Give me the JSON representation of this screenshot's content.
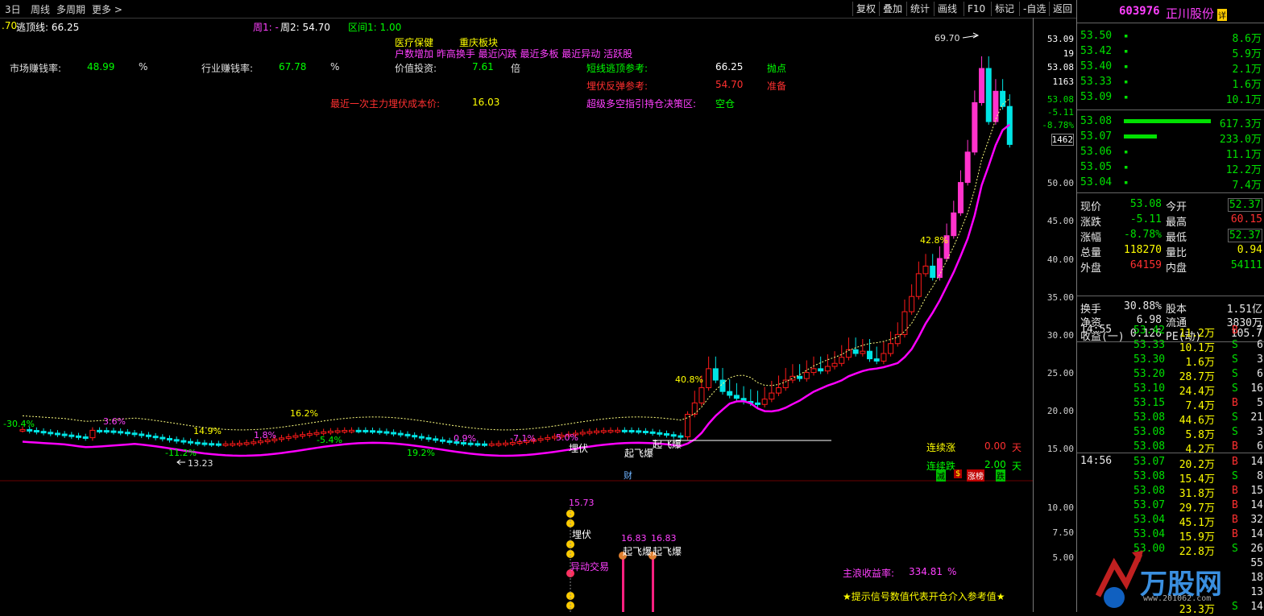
{
  "toolbar": {
    "left": [
      "3日",
      "周线",
      "多周期",
      "更多 >"
    ],
    "right": [
      "复权",
      "叠加",
      "统计",
      "画线",
      "F10",
      "标记",
      "-自选",
      "返回"
    ]
  },
  "indicator_line": {
    "prefix": ".70",
    "escape_label": "逃顶线: 66.25",
    "week1": "周1: -",
    "week2": "周2: 54.70",
    "range": "区间1: 1.00"
  },
  "sector": {
    "tag1": "医疗保健",
    "tag2": "重庆板块",
    "line2": "户数增加 昨高换手 最近闪跌 最近多板 最近异动 活跃股"
  },
  "stats": {
    "market_label": "市场赚钱率:",
    "market_value": "48.99",
    "market_unit": "%",
    "industry_label": "行业赚钱率:",
    "industry_value": "67.78",
    "industry_unit": "%",
    "value_label": "价值投资:",
    "value_value": "7.61",
    "value_unit": "倍",
    "short_label": "短线逃顶参考:",
    "short_value": "66.25",
    "short_tag": "抛点",
    "rebound_label": "埋伏反弹参考:",
    "rebound_value": "54.70",
    "rebound_tag": "准备",
    "cost_label": "最近一次主力埋伏成本价:",
    "cost_value": "16.03",
    "strategy_label": "超级多空指引持仓决策区:",
    "strategy_value": "空仓"
  },
  "chart_labels": {
    "peak": "69.70",
    "low": "13.23",
    "pcts": [
      "-30.4%",
      "3.6%",
      "14.9%",
      "16.2%",
      "-11.2%",
      "1.8%",
      "-5.4%",
      "19.2%",
      "0.9%",
      "-7.1%",
      "5.0%",
      "40.8%",
      "42.8%"
    ],
    "signals": [
      "埋伏",
      "起飞爆",
      "起飞爆",
      "财"
    ],
    "lianxu_zhang": "连续涨",
    "lianxu_zhang_val": "0.00",
    "lianxu_zhang_unit": "天",
    "lianxu_die": "连续跌",
    "lianxu_die_val": "2.00",
    "lianxu_die_unit": "天",
    "bottom_tags": [
      "减",
      "$",
      "涨榜",
      "跌"
    ]
  },
  "sub_chart": {
    "val1": "15.73",
    "val2": "16.83",
    "val3": "16.83",
    "sig1": "埋伏",
    "sig2": "起飞爆",
    "sig3": "起飞爆",
    "sig4": "异动交易",
    "profit_label": "主浪收益率:",
    "profit_value": "334.81",
    "profit_unit": "%",
    "note": "★提示信号数值代表开仓介入参考值★"
  },
  "price_axis": {
    "main": [
      "50.00",
      "45.00",
      "40.00",
      "35.00",
      "30.00",
      "25.00",
      "20.00",
      "15.00"
    ],
    "sub": [
      "10.00",
      "7.50",
      "5.00"
    ],
    "flags": [
      "53.09",
      "19",
      "53.08",
      "1163",
      "53.08",
      "-5.11",
      "-8.78%",
      "1462"
    ]
  },
  "quote": {
    "code": "603976",
    "name": "正川股份",
    "badge": "详",
    "asks": [
      {
        "p": "53.50",
        "v": "8.6万"
      },
      {
        "p": "53.42",
        "v": "5.9万"
      },
      {
        "p": "53.40",
        "v": "2.1万"
      },
      {
        "p": "53.33",
        "v": "1.6万"
      },
      {
        "p": "53.09",
        "v": "10.1万"
      }
    ],
    "bids": [
      {
        "p": "53.08",
        "v": "617.3万",
        "bar": 1.0
      },
      {
        "p": "53.07",
        "v": "233.0万",
        "bar": 0.38
      },
      {
        "p": "53.06",
        "v": "11.1万",
        "bar": 0
      },
      {
        "p": "53.05",
        "v": "12.2万",
        "bar": 0
      },
      {
        "p": "53.04",
        "v": "7.4万",
        "bar": 0
      }
    ],
    "info": [
      {
        "l1": "现价",
        "v1": "53.08",
        "l2": "今开",
        "v2": "52.37",
        "c1": "green",
        "c2": "green",
        "b2": true
      },
      {
        "l1": "涨跌",
        "v1": "-5.11",
        "l2": "最高",
        "v2": "60.15",
        "c1": "green",
        "c2": "red",
        "b2": false
      },
      {
        "l1": "涨幅",
        "v1": "-8.78%",
        "l2": "最低",
        "v2": "52.37",
        "c1": "green",
        "c2": "green",
        "b2": true
      },
      {
        "l1": "总量",
        "v1": "118270",
        "l2": "量比",
        "v2": "0.94",
        "c1": "yellow",
        "c2": "yellow",
        "b2": false
      },
      {
        "l1": "外盘",
        "v1": "64159",
        "l2": "内盘",
        "v2": "54111",
        "c1": "red",
        "c2": "green",
        "b2": false
      }
    ],
    "info2": [
      {
        "l1": "换手",
        "v1": "30.88%",
        "l2": "股本",
        "v2": "1.51亿"
      },
      {
        "l1": "净资",
        "v1": "6.98",
        "l2": "流通",
        "v2": "3830万"
      },
      {
        "l1": "收益(一)",
        "v1": "0.126",
        "l2": "PE(动)",
        "v2": "105.7"
      }
    ],
    "ticks1_time": "14:55",
    "ticks1": [
      {
        "p": "53.42",
        "v": "11.2万",
        "d": "B",
        "n": "7"
      },
      {
        "p": "53.33",
        "v": "10.1万",
        "d": "S",
        "n": "6"
      },
      {
        "p": "53.30",
        "v": "1.6万",
        "d": "S",
        "n": "3"
      },
      {
        "p": "53.20",
        "v": "28.7万",
        "d": "S",
        "n": "6"
      },
      {
        "p": "53.10",
        "v": "24.4万",
        "d": "S",
        "n": "16"
      },
      {
        "p": "53.15",
        "v": "7.4万",
        "d": "B",
        "n": "5"
      },
      {
        "p": "53.08",
        "v": "44.6万",
        "d": "S",
        "n": "21"
      },
      {
        "p": "53.08",
        "v": "5.8万",
        "d": "S",
        "n": "3"
      },
      {
        "p": "53.08",
        "v": "4.2万",
        "d": "B",
        "n": "6"
      }
    ],
    "ticks2_time": "14:56",
    "ticks2": [
      {
        "p": "53.07",
        "v": "20.2万",
        "d": "B",
        "n": "14"
      },
      {
        "p": "53.08",
        "v": "15.4万",
        "d": "S",
        "n": "8"
      },
      {
        "p": "53.08",
        "v": "31.8万",
        "d": "B",
        "n": "15"
      },
      {
        "p": "53.07",
        "v": "29.7万",
        "d": "B",
        "n": "14"
      },
      {
        "p": "53.04",
        "v": "45.1万",
        "d": "B",
        "n": "32"
      },
      {
        "p": "53.04",
        "v": "15.9万",
        "d": "B",
        "n": "14"
      },
      {
        "p": "53.00",
        "v": "22.8万",
        "d": "S",
        "n": "26"
      },
      {
        "p": "",
        "v": "",
        "d": "",
        "n": "55"
      },
      {
        "p": "",
        "v": "",
        "d": "",
        "n": "18"
      },
      {
        "p": "",
        "v": "",
        "d": "",
        "n": "13"
      },
      {
        "p": "",
        "v": "23.3万",
        "d": "S",
        "n": "14"
      }
    ],
    "watermark": "万股网",
    "watermark_url": "www.201062.com"
  },
  "colors": {
    "up": "#ff1a1a",
    "down": "#00e5e5",
    "peak": "#ff33cc",
    "bull_line": "#ff00ff",
    "guide": "#ffff80"
  }
}
